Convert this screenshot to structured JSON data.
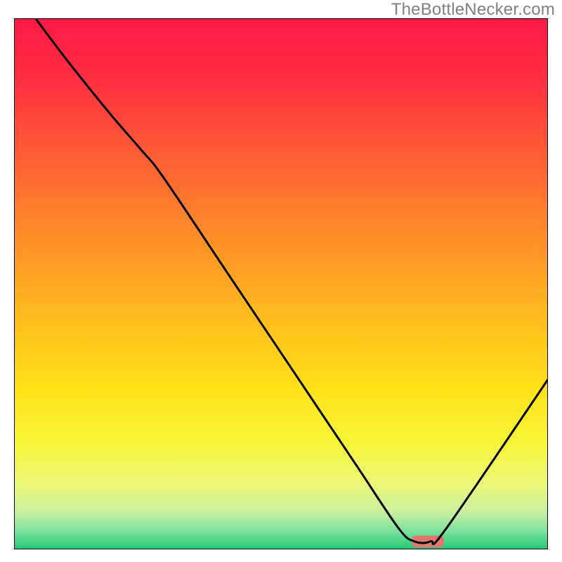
{
  "watermark": "TheBottleNecker.com",
  "chart_data": {
    "type": "line",
    "title": "",
    "xlabel": "",
    "ylabel": "",
    "xlim": [
      0,
      100
    ],
    "ylim": [
      0,
      100
    ],
    "gradient_stops": [
      {
        "offset": 0.0,
        "color": "#ff1a46"
      },
      {
        "offset": 0.1,
        "color": "#ff2b42"
      },
      {
        "offset": 0.25,
        "color": "#ff5a36"
      },
      {
        "offset": 0.4,
        "color": "#ff8a29"
      },
      {
        "offset": 0.55,
        "color": "#ffb81f"
      },
      {
        "offset": 0.7,
        "color": "#ffe219"
      },
      {
        "offset": 0.8,
        "color": "#f8f53a"
      },
      {
        "offset": 0.88,
        "color": "#eaf77a"
      },
      {
        "offset": 0.93,
        "color": "#c9f0a0"
      },
      {
        "offset": 0.965,
        "color": "#7ee2a0"
      },
      {
        "offset": 1.0,
        "color": "#22c776"
      }
    ],
    "series": [
      {
        "name": "bottleneck-curve",
        "color": "#000000",
        "x": [
          4,
          10,
          18,
          24,
          28,
          40,
          52,
          64,
          72,
          75,
          78,
          81,
          100
        ],
        "values": [
          100,
          92,
          82,
          75,
          70,
          52,
          34,
          16,
          4,
          1.5,
          1.5,
          4,
          32
        ]
      }
    ],
    "marker": {
      "name": "target-marker",
      "x_start": 74.5,
      "x_end": 80.5,
      "y": 1.5,
      "color": "#e2766f",
      "height": 2.2
    },
    "axes": {
      "show_frame": true,
      "frame_color": "#000000",
      "frame_width": 2
    }
  }
}
